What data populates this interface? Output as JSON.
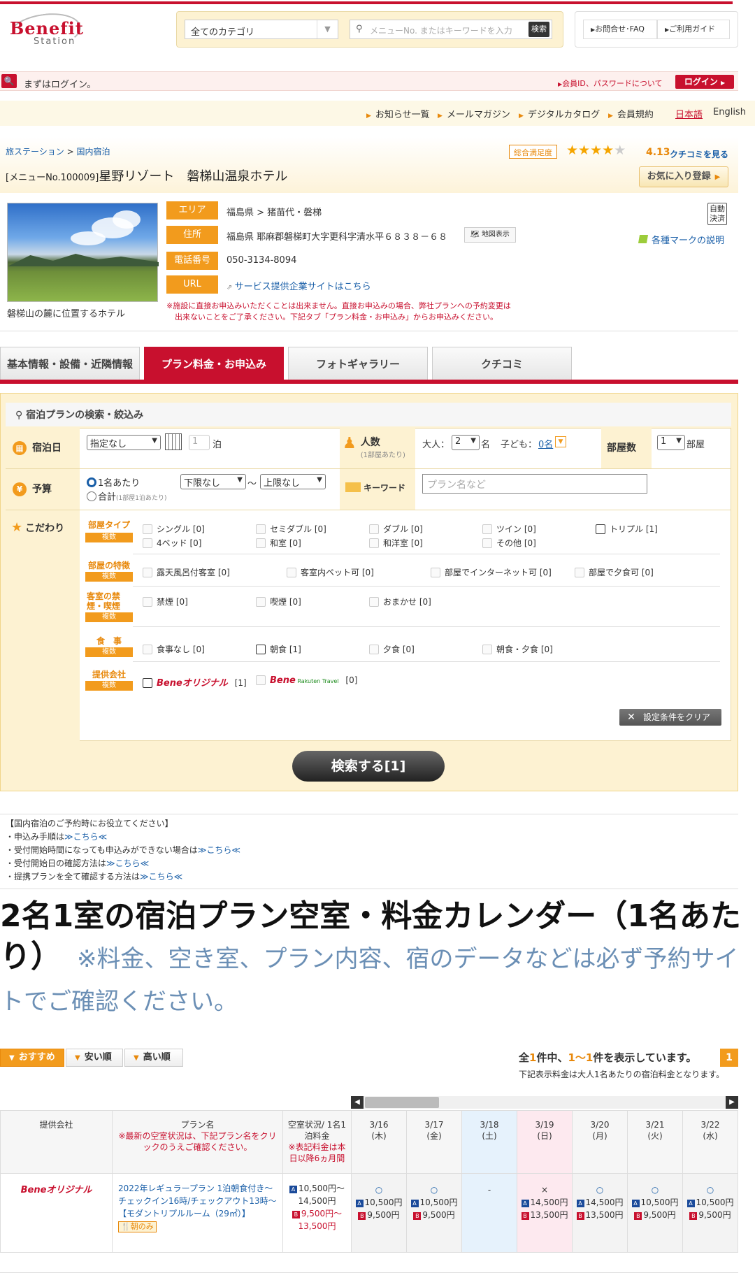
{
  "header": {
    "logo": "Benefit",
    "logo_sub": "Station",
    "category_select": "全てのカテゴリ",
    "search_placeholder": "メニューNo. またはキーワードを入力",
    "search_button": "検索",
    "faq": "お問合せ･FAQ",
    "guide": "ご利用ガイド"
  },
  "login": {
    "message": "まずはログイン。",
    "id_pw_link": "会員ID、パスワードについて",
    "button": "ログイン"
  },
  "subnav": {
    "items": [
      "お知らせ一覧",
      "メールマガジン",
      "デジタルカタログ",
      "会員規約"
    ],
    "lang_ja": "日本語",
    "lang_en": "English"
  },
  "hotel": {
    "breadcrumb": [
      "旅ステーション",
      "国内宿泊"
    ],
    "menu_no": "[メニューNo.100009]",
    "name": "星野リゾート　磐梯山温泉ホテル",
    "satisfaction_label": "総合満足度",
    "rating": "4.13",
    "rating_stars": 4,
    "reviews_link": "クチコミを見る",
    "favorite": "お気に入り登録",
    "photo_caption": "磐梯山の麓に位置するホテル",
    "fields": [
      {
        "label": "エリア",
        "value": "福島県 > 猪苗代・磐梯"
      },
      {
        "label": "住所",
        "value": "福島県 耶麻郡磐梯町大字更科字清水平６８３８－６８"
      },
      {
        "label": "電話番号",
        "value": "050-3134-8094"
      },
      {
        "label": "URL",
        "value": "サービス提供企業サイトはこちら"
      }
    ],
    "map_button": "地図表示",
    "auto_badge": "自動決済",
    "mark_explanation": "各種マークの説明",
    "notice": [
      "※施設に直接お申込みいただくことは出来ません。直接お申込みの場合、弊社プランへの予約変更は",
      "出来ないことをご了承ください。下記タブ「プラン料金・お申込み」からお申込みください。"
    ]
  },
  "tabs": [
    {
      "label": "基本情報・設備・近隣情報",
      "active": false
    },
    {
      "label": "プラン料金・お申込み",
      "active": true
    },
    {
      "label": "フォトギャラリー",
      "active": false
    },
    {
      "label": "クチコミ",
      "active": false
    }
  ],
  "search": {
    "title": "宿泊プランの検索・絞込み",
    "stay_label": "宿泊日",
    "date_select": "指定なし",
    "nights": "1",
    "nights_unit": "泊",
    "people_label": "人数",
    "people_sub": "(1部屋あたり)",
    "adults_label": "大人：",
    "adults": "2",
    "adults_unit": "名",
    "children_label": "子ども：",
    "children": "0名",
    "rooms_label": "部屋数",
    "rooms": "1",
    "rooms_unit": "部屋",
    "budget_label": "予算",
    "budget_per_person": "1名あたり",
    "budget_total": "合計",
    "budget_total_sub": "(1部屋1泊あたり)",
    "budget_min": "下限なし",
    "budget_sep": "～",
    "budget_max": "上限なし",
    "keyword_label": "キーワード",
    "keyword_placeholder": "プラン名など",
    "kodawari_label": "こだわり",
    "multi": "複数",
    "groups": [
      {
        "label": "部屋タイプ",
        "rows": [
          [
            "シングル [0]",
            "セミダブル [0]",
            "ダブル [0]",
            "ツイン [0]",
            "トリプル [1]"
          ],
          [
            "4ベッド [0]",
            "和室 [0]",
            "和洋室 [0]",
            "その他 [0]"
          ]
        ]
      },
      {
        "label": "部屋の特徴",
        "rows": [
          [
            "露天風呂付客室 [0]",
            "客室内ペット可 [0]",
            "部屋でインターネット可 [0]",
            "部屋で夕食可 [0]"
          ]
        ]
      },
      {
        "label": "客室の禁煙・喫煙",
        "rows": [
          [
            "禁煙 [0]",
            "喫煙 [0]",
            "おまかせ [0]"
          ]
        ]
      },
      {
        "label": "食　事",
        "rows": [
          [
            "食事なし [0]",
            "朝食 [1]",
            "夕食 [0]",
            "朝食・夕食 [0]"
          ]
        ]
      },
      {
        "label": "提供会社",
        "rows": [
          [
            "Beneオリジナル [1]",
            "Bene Rakuten Travel [0]"
          ]
        ]
      }
    ],
    "clear_button": "設定条件をクリア",
    "search_button": "検索する[1]"
  },
  "info": {
    "title": "【国内宿泊のご予約時にお役立てください】",
    "items": [
      {
        "text": "・申込み手順は",
        "link": "≫こちら≪"
      },
      {
        "text": "・受付開始時間になっても申込みができない場合は",
        "link": "≫こちら≪"
      },
      {
        "text": "・受付開始日の確認方法は",
        "link": "≫こちら≪"
      },
      {
        "text": "・提携プランを全て確認する方法は",
        "link": "≫こちら≪"
      }
    ]
  },
  "calendar": {
    "title": "2名1室の宿泊プラン空室・料金カレンダー（1名あたり）",
    "note": "※料金、空き室、プラン内容、宿のデータなどは必ず予約サイトでご確認ください。",
    "sort": [
      "おすすめ順",
      "安い順",
      "高い順"
    ],
    "count_total": "1",
    "count_range": "1〜1",
    "count_text_a": "全",
    "count_text_b": "件中、",
    "count_text_c": "件を表示しています。",
    "page": "1",
    "price_note": "下記表示料金は大人1名あたりの宿泊料金となります。",
    "col_provider": "提供会社",
    "col_plan": "プラン名",
    "col_plan_note": "※最新の空室状況は、下記プラン名をクリックのうえご確認ください。",
    "col_status": "空室状況/ 1名1泊料金",
    "col_status_note": "※表記料金は本日以降6ヵ月間",
    "dates": [
      {
        "d": "3/16",
        "w": "(木)"
      },
      {
        "d": "3/17",
        "w": "(金)"
      },
      {
        "d": "3/18",
        "w": "(土)"
      },
      {
        "d": "3/19",
        "w": "(日)"
      },
      {
        "d": "3/20",
        "w": "(月)"
      },
      {
        "d": "3/21",
        "w": "(火)"
      },
      {
        "d": "3/22",
        "w": "(水)"
      }
    ],
    "row": {
      "provider": "Beneオリジナル",
      "plan": "2022年レギュラープラン 1泊朝食付き～チェックイン16時/チェックアウト13時～",
      "room": "【モダントリプルルーム（29㎡）】",
      "meal": "朝のみ",
      "range_a1": "10,500円～",
      "range_a2": "14,500円",
      "range_b1": "9,500円～",
      "range_b2": "13,500円",
      "days": [
        {
          "s": "○",
          "a": "10,500円",
          "b": "9,500円"
        },
        {
          "s": "○",
          "a": "10,500円",
          "b": "9,500円"
        },
        {
          "s": "-",
          "a": "",
          "b": ""
        },
        {
          "s": "×",
          "a": "14,500円",
          "b": "13,500円"
        },
        {
          "s": "○",
          "a": "14,500円",
          "b": "13,500円"
        },
        {
          "s": "○",
          "a": "10,500円",
          "b": "9,500円"
        },
        {
          "s": "○",
          "a": "10,500円",
          "b": "9,500円"
        }
      ]
    }
  },
  "colors": {
    "brand_red": "#c8102e",
    "accent_orange": "#f29b1d",
    "link_blue": "#1a5fa8",
    "saturday_bg": "#e6f2fc",
    "sunday_bg": "#fde9ef"
  }
}
